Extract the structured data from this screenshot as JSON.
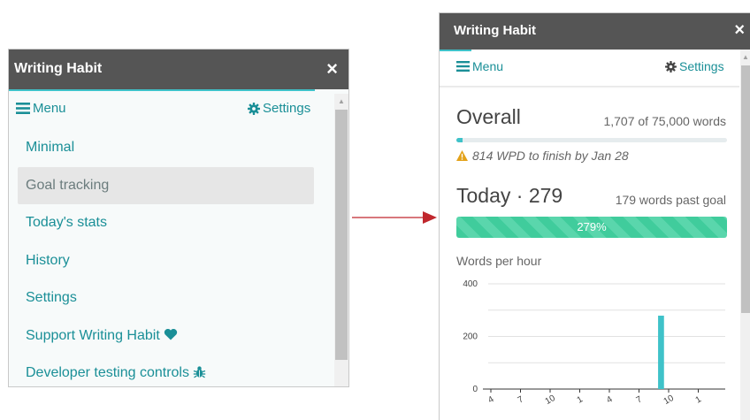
{
  "left_panel": {
    "title": "Writing Habit",
    "close_icon": "×",
    "menu_label": "Menu",
    "settings_label": "Settings",
    "nav": [
      {
        "label": "Minimal",
        "active": false
      },
      {
        "label": "Goal tracking",
        "active": true
      },
      {
        "label": "Today's stats",
        "active": false
      },
      {
        "label": "History",
        "active": false
      },
      {
        "label": "Settings",
        "active": false
      },
      {
        "label": "Support Writing Habit",
        "icon": "heart-icon",
        "active": false
      },
      {
        "label": "Developer testing controls",
        "icon": "bug-icon",
        "active": false
      }
    ]
  },
  "right_panel": {
    "title": "Writing Habit",
    "close_icon": "×",
    "menu_label": "Menu",
    "settings_label": "Settings",
    "overall": {
      "label": "Overall",
      "summary": "1,707 of 75,000 words",
      "progress_fraction": 0.0228,
      "warning": "814 WPD to finish by Jan 28"
    },
    "today": {
      "label": "Today · 279",
      "summary": "179 words past goal",
      "progress_text": "279%",
      "progress_fraction": 1.0
    },
    "chart_data": {
      "type": "bar",
      "title": "Words per hour",
      "xlabel": "",
      "ylabel": "",
      "ylim": [
        0,
        400
      ],
      "yticks": [
        0,
        200,
        400
      ],
      "grid": true,
      "x_tick_labels": [
        "4",
        "7",
        "10",
        "1",
        "4",
        "7",
        "10",
        "1"
      ],
      "values": [
        0,
        0,
        0,
        0,
        0,
        0,
        0,
        0,
        0,
        0,
        0,
        0,
        0,
        0,
        0,
        0,
        0,
        279,
        0,
        0,
        0,
        0,
        0,
        0
      ],
      "bar_color": "#3fc2c9"
    }
  },
  "colors": {
    "titlebar": "#555555",
    "accent": "#3fc2c9",
    "link": "#1a8f97",
    "goal_bar": "#40cc9c",
    "warning": "#e3a21a",
    "arrow": "#c0272d"
  }
}
